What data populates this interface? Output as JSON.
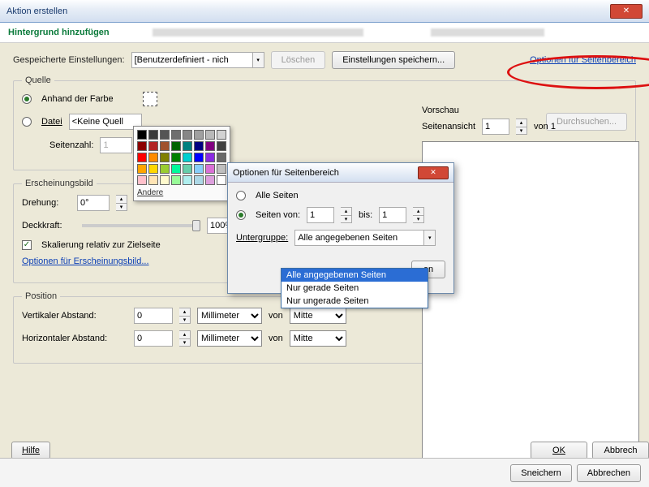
{
  "window": {
    "title": "Aktion erstellen"
  },
  "subtitle": "Hintergrund hinzufügen",
  "saved": {
    "label": "Gespeicherte Einstellungen:",
    "value": "[Benutzerdefiniert - nich",
    "delete": "Löschen",
    "save": "Einstellungen speichern..."
  },
  "link_page_options": "Optionen für Seitenbereich",
  "source": {
    "legend": "Quelle",
    "byColor": "Anhand der Farbe",
    "file": "Datei",
    "fileValue": "<Keine Quell",
    "browse": "Durchsuchen...",
    "pageCount": "Seitenzahl:",
    "pageCountValue": "1",
    "palette_more": "Andere"
  },
  "appearance": {
    "legend": "Erscheinungsbild",
    "rotation": "Drehung:",
    "rotationValue": "0°",
    "opacity": "Deckkraft:",
    "opacityValue": "100%",
    "scale": "Skalierung relativ zur Zielseite",
    "link": "Optionen für Erscheinungsbild..."
  },
  "position": {
    "legend": "Position",
    "vert": "Vertikaler Abstand:",
    "horiz": "Horizontaler Abstand:",
    "value": "0",
    "unit": "Millimeter",
    "from": "von",
    "ref": "Mitte"
  },
  "preview": {
    "legend": "Vorschau",
    "pageView": "Seitenansicht",
    "pageValue": "1",
    "of": "von 1"
  },
  "buttons": {
    "help": "Hilfe",
    "ok": "OK",
    "cancel": "Abbrech"
  },
  "footer": {
    "save": "Sneichern",
    "cancel": "Abbrechen"
  },
  "dlg2": {
    "title": "Optionen für Seitenbereich",
    "all": "Alle Seiten",
    "pagesFrom": "Seiten von:",
    "fromValue": "1",
    "to": "bis:",
    "toValue": "1",
    "subgroup": "Untergruppe:",
    "selected": "Alle angegebenen Seiten",
    "opt1": "Alle angegebenen Seiten",
    "opt2": "Nur gerade Seiten",
    "opt3": "Nur ungerade Seiten",
    "okHint": "en"
  },
  "palette_colors": [
    "#000000",
    "#3b3b3b",
    "#555555",
    "#6e6e6e",
    "#878787",
    "#a0a0a0",
    "#b9b9b9",
    "#d2d2d2",
    "#8b0000",
    "#b22222",
    "#a0522d",
    "#006400",
    "#008080",
    "#000080",
    "#800080",
    "#404040",
    "#ff0000",
    "#ff8c00",
    "#808000",
    "#008000",
    "#00ced1",
    "#0000ff",
    "#8a2be2",
    "#696969",
    "#ffa500",
    "#ffd700",
    "#9acd32",
    "#00fa9a",
    "#66cdaa",
    "#87cefa",
    "#da70d6",
    "#c0c0c0",
    "#ffc0cb",
    "#ffe4b5",
    "#fffacd",
    "#98fb98",
    "#afeeee",
    "#add8e6",
    "#dda0dd",
    "#ffffff"
  ]
}
